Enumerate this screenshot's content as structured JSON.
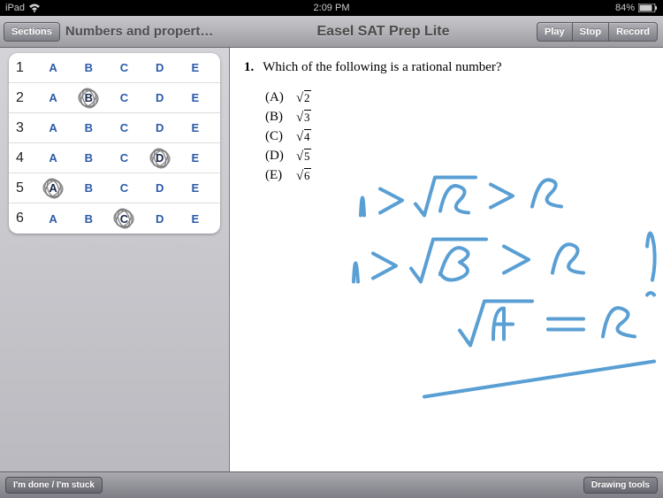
{
  "status": {
    "device": "iPad",
    "time": "2:09 PM",
    "battery": "84%"
  },
  "toolbar": {
    "sections_btn": "Sections",
    "section_title": "Numbers and propert…",
    "app_title": "Easel SAT Prep Lite",
    "play": "Play",
    "stop": "Stop",
    "record": "Record"
  },
  "answer_rows": [
    {
      "num": "1",
      "choices": [
        "A",
        "B",
        "C",
        "D",
        "E"
      ],
      "selected": null
    },
    {
      "num": "2",
      "choices": [
        "A",
        "B",
        "C",
        "D",
        "E"
      ],
      "selected": "B"
    },
    {
      "num": "3",
      "choices": [
        "A",
        "B",
        "C",
        "D",
        "E"
      ],
      "selected": null
    },
    {
      "num": "4",
      "choices": [
        "A",
        "B",
        "C",
        "D",
        "E"
      ],
      "selected": "D"
    },
    {
      "num": "5",
      "choices": [
        "A",
        "B",
        "C",
        "D",
        "E"
      ],
      "selected": "A"
    },
    {
      "num": "6",
      "choices": [
        "A",
        "B",
        "C",
        "D",
        "E"
      ],
      "selected": "C"
    }
  ],
  "question": {
    "number": "1.",
    "text": "Which of the following is a rational number?",
    "options": [
      {
        "label": "(A)",
        "radicand": "2"
      },
      {
        "label": "(B)",
        "radicand": "3"
      },
      {
        "label": "(C)",
        "radicand": "4"
      },
      {
        "label": "(D)",
        "radicand": "5"
      },
      {
        "label": "(E)",
        "radicand": "6"
      }
    ]
  },
  "bottom": {
    "done": "I'm done / I'm stuck",
    "drawing": "Drawing tools"
  },
  "colors": {
    "ink": "#5a9fd4"
  }
}
